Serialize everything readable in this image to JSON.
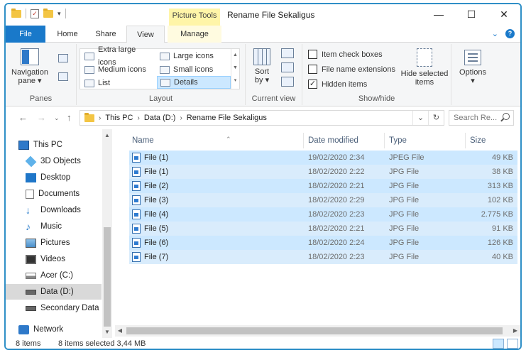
{
  "window": {
    "title": "Rename File Sekaligus",
    "context_tab": "Picture Tools",
    "minimize": "—",
    "maximize": "☐",
    "close": "✕"
  },
  "tabs": {
    "file": "File",
    "home": "Home",
    "share": "Share",
    "view": "View",
    "manage": "Manage",
    "expand": "⌄",
    "help": "?"
  },
  "ribbon": {
    "panes": {
      "label": "Panes",
      "navigation_pane": "Navigation",
      "navigation_pane_2": "pane ▾"
    },
    "layout": {
      "label": "Layout",
      "items": [
        "Extra large icons",
        "Large icons",
        "Medium icons",
        "Small icons",
        "List",
        "Details"
      ]
    },
    "current_view": {
      "label": "Current view",
      "sort": "Sort",
      "sort_2": "by ▾"
    },
    "show_hide": {
      "label": "Show/hide",
      "item_check_boxes": "Item check boxes",
      "file_name_extensions": "File name extensions",
      "hidden_items": "Hidden items",
      "hide_selected": "Hide selected",
      "hide_selected_2": "items",
      "options": "Options",
      "options_drop": "▾"
    }
  },
  "address": {
    "this_pc": "This PC",
    "drive": "Data (D:)",
    "folder": "Rename File Sekaligus",
    "search_placeholder": "Search Re..."
  },
  "nav": {
    "items": [
      "This PC",
      "3D Objects",
      "Desktop",
      "Documents",
      "Downloads",
      "Music",
      "Pictures",
      "Videos",
      "Acer (C:)",
      "Data (D:)",
      "Secondary Data",
      "Network"
    ]
  },
  "columns": {
    "name": "Name",
    "date": "Date modified",
    "type": "Type",
    "size": "Size"
  },
  "files": [
    {
      "name": "File (1)",
      "date": "19/02/2020 2:34",
      "type": "JPEG File",
      "size": "49 KB"
    },
    {
      "name": "File (1)",
      "date": "18/02/2020 2:22",
      "type": "JPG File",
      "size": "38 KB"
    },
    {
      "name": "File (2)",
      "date": "18/02/2020 2:21",
      "type": "JPG File",
      "size": "313 KB"
    },
    {
      "name": "File (3)",
      "date": "18/02/2020 2:29",
      "type": "JPG File",
      "size": "102 KB"
    },
    {
      "name": "File (4)",
      "date": "18/02/2020 2:23",
      "type": "JPG File",
      "size": "2.775 KB"
    },
    {
      "name": "File (5)",
      "date": "18/02/2020 2:21",
      "type": "JPG File",
      "size": "91 KB"
    },
    {
      "name": "File (6)",
      "date": "18/02/2020 2:24",
      "type": "JPG File",
      "size": "126 KB"
    },
    {
      "name": "File (7)",
      "date": "18/02/2020 2:23",
      "type": "JPG File",
      "size": "40 KB"
    }
  ],
  "status": {
    "count": "8 items",
    "selected": "8 items selected  3,44 MB"
  },
  "colors": {
    "accent": "#1979ca",
    "selection": "#cce8ff",
    "frame": "#2f8fc7"
  }
}
